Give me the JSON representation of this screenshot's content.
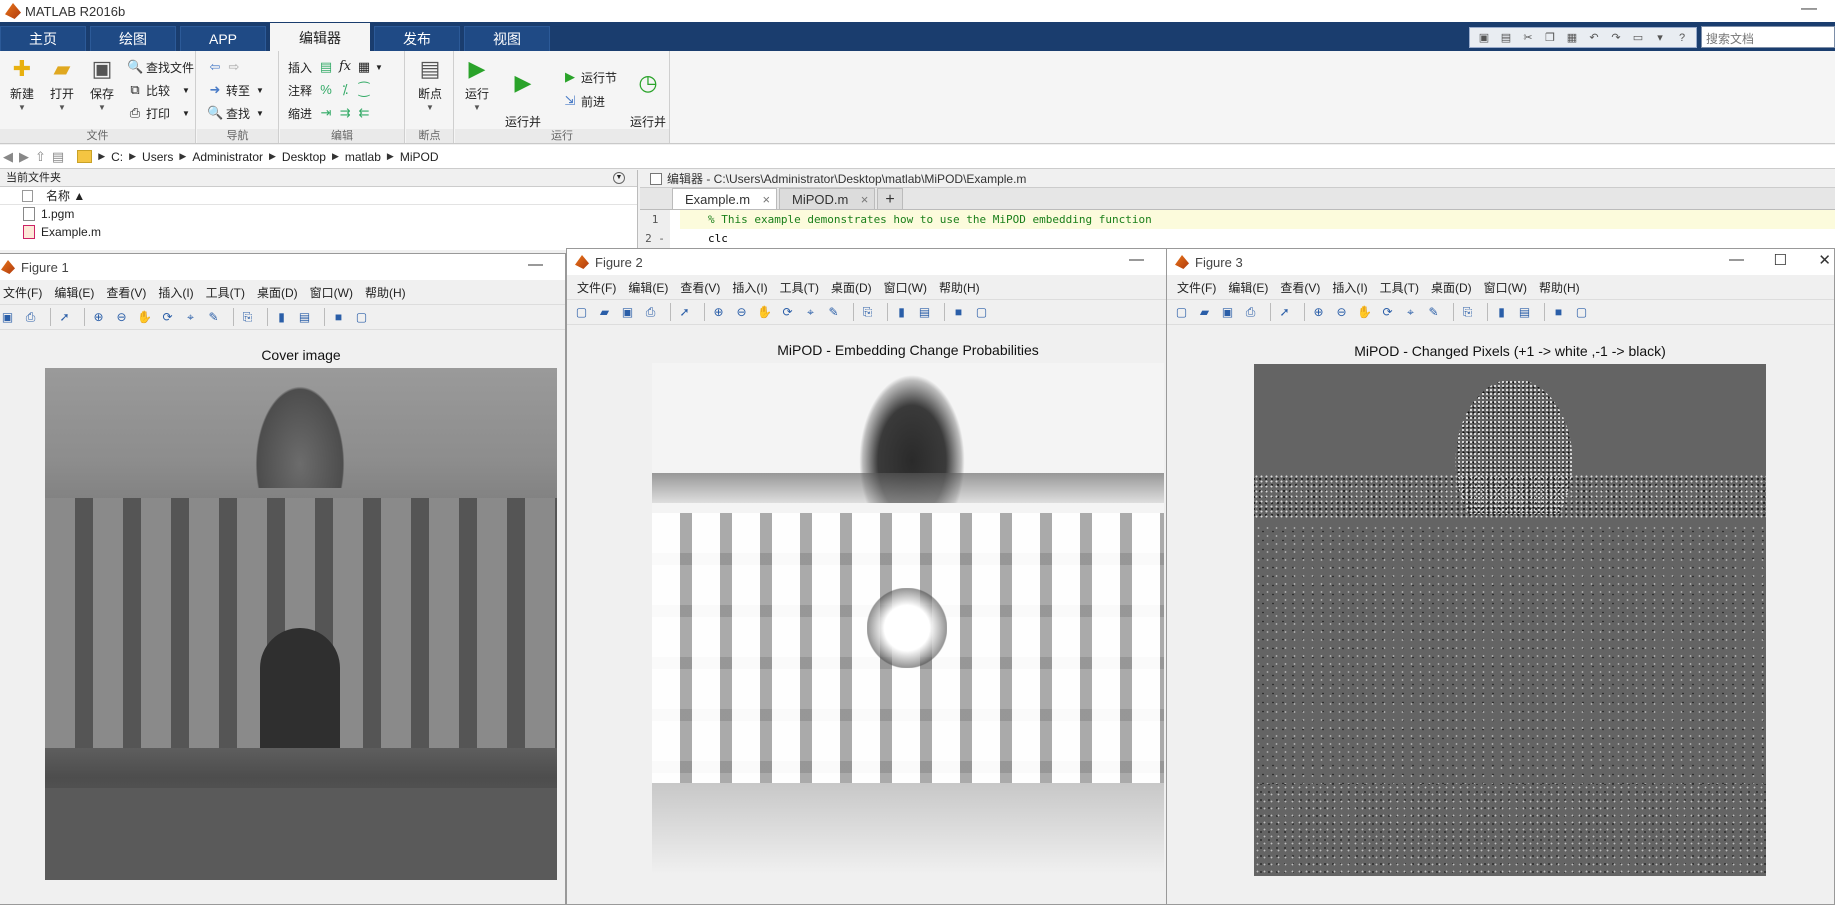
{
  "app": {
    "title": "MATLAB R2016b"
  },
  "ribbon_tabs": [
    "主页",
    "绘图",
    "APP",
    "编辑器",
    "发布",
    "视图"
  ],
  "active_tab": "编辑器",
  "search": {
    "placeholder": "搜索文档"
  },
  "ribbon": {
    "file": {
      "label": "文件",
      "new": "新建",
      "open": "打开",
      "save": "保存",
      "find_files": "查找文件",
      "compare": "比较",
      "print": "打印"
    },
    "nav": {
      "label": "导航",
      "goto": "转至",
      "find": "查找"
    },
    "edit": {
      "label": "编辑",
      "insert": "插入",
      "comment": "注释",
      "indent": "缩进",
      "fx": "fx"
    },
    "breakpoints": {
      "label": "断点",
      "btn": "断点"
    },
    "run": {
      "label": "运行",
      "run": "运行",
      "run_advance": "运行并\n前进",
      "run_section": "运行节",
      "advance": "前进",
      "run_time": "运行并\n计时"
    }
  },
  "address": [
    "C:",
    "Users",
    "Administrator",
    "Desktop",
    "matlab",
    "MiPOD"
  ],
  "current_folder": {
    "title": "当前文件夹",
    "column": "名称 ▲",
    "files": [
      "1.pgm",
      "Example.m"
    ]
  },
  "editor": {
    "title": "编辑器 - C:\\Users\\Administrator\\Desktop\\matlab\\MiPOD\\Example.m",
    "tabs": [
      "Example.m",
      "MiPOD.m"
    ],
    "lines": [
      {
        "n": "1",
        "text": "% This example demonstrates how to use the MiPOD embedding function"
      },
      {
        "n": "2 -",
        "text": "clc"
      }
    ]
  },
  "figure_menu": [
    "文件(F)",
    "编辑(E)",
    "查看(V)",
    "插入(I)",
    "工具(T)",
    "桌面(D)",
    "窗口(W)",
    "帮助(H)"
  ],
  "figures": [
    {
      "title": "Figure 1",
      "axes_title": "Cover image"
    },
    {
      "title": "Figure 2",
      "axes_title": "MiPOD - Embedding Change Probabilities"
    },
    {
      "title": "Figure 3",
      "axes_title": "MiPOD - Changed Pixels (+1 -> white ,-1 -> black)"
    }
  ],
  "colors": {
    "ribbon_bar": "#1a3d6e",
    "code_comment": "#1a7f1a"
  }
}
